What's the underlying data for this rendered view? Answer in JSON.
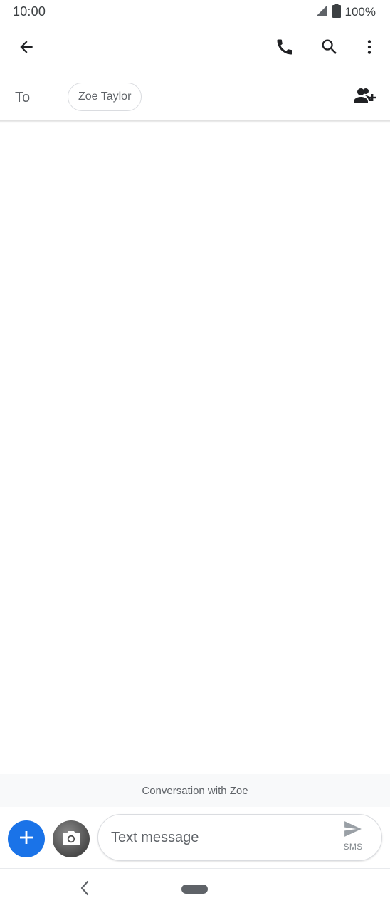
{
  "status_bar": {
    "time": "10:00",
    "battery_text": "100%",
    "icons": [
      "signal-icon",
      "battery-icon"
    ]
  },
  "app_bar": {
    "icons": [
      "back-arrow-icon",
      "phone-icon",
      "search-icon",
      "more-vert-icon"
    ]
  },
  "recipients": {
    "to_label": "To",
    "chips": [
      {
        "label": "Zoe Taylor"
      }
    ],
    "add_icon": "add-person-icon"
  },
  "conversation": {
    "banner": "Conversation with Zoe"
  },
  "compose": {
    "placeholder": "Text message",
    "value": "",
    "send_label": "SMS",
    "attach_icon": "plus-icon",
    "camera_icon": "camera-icon",
    "send_icon": "send-icon"
  },
  "nav_bar": {
    "icons": [
      "nav-back-icon",
      "home-pill-icon"
    ]
  },
  "colors": {
    "accent": "#1a73e8",
    "text_secondary": "#5f6368",
    "divider": "#dadce0",
    "banner_bg": "#f8f9fa"
  }
}
